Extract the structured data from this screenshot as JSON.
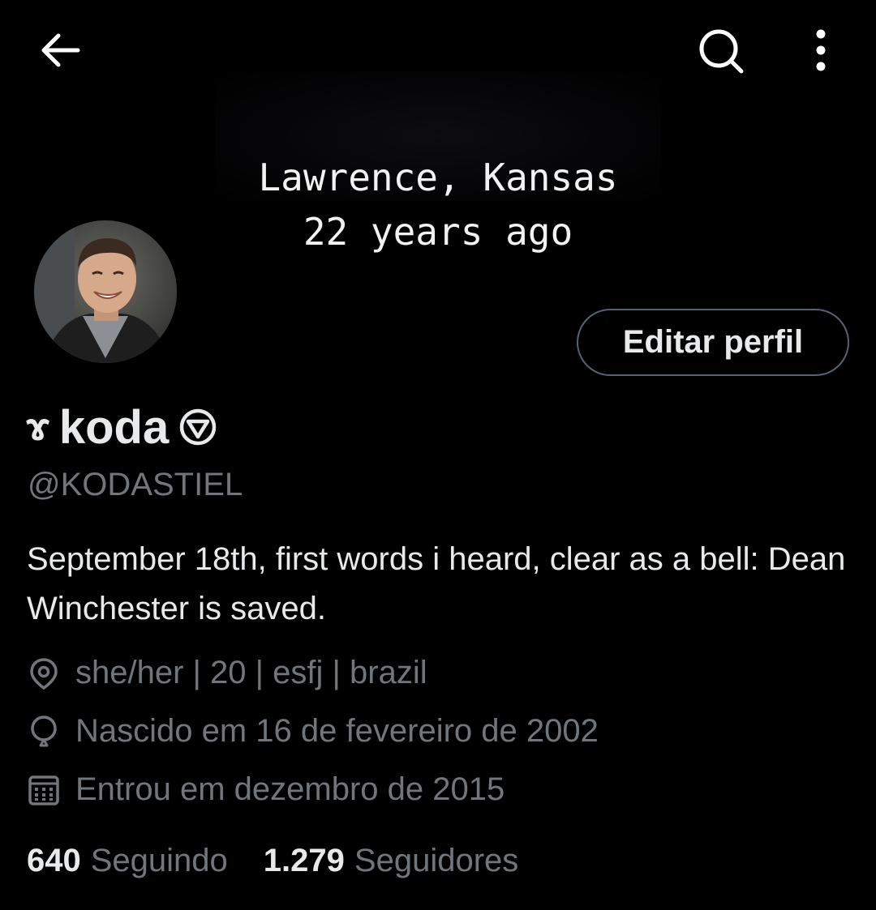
{
  "header": {
    "back_icon": "arrow-left-icon",
    "search_icon": "search-icon",
    "more_icon": "more-vertical-icon"
  },
  "banner": {
    "line1": "Lawrence, Kansas",
    "line2": "22 years ago"
  },
  "profile": {
    "avatar_icon": "profile-photo",
    "edit_button_label": "Editar perfil",
    "name_prefix": "ɤ",
    "display_name": "koda",
    "name_suffix": "⊜",
    "handle": "@KODASTIEL",
    "bio": "September 18th, first words i heard, clear as a bell: Dean Winchester is saved.",
    "location": "she/her | 20 | esfj | brazil",
    "birth": "Nascido em 16 de fevereiro de 2002",
    "joined": "Entrou em dezembro de 2015"
  },
  "stats": {
    "following_count": "640",
    "following_label": "Seguindo",
    "followers_count": "1.279",
    "followers_label": "Seguidores"
  },
  "colors": {
    "background": "#000000",
    "text_primary": "#e7e9ea",
    "text_secondary": "#71767b",
    "button_border": "#536471"
  }
}
